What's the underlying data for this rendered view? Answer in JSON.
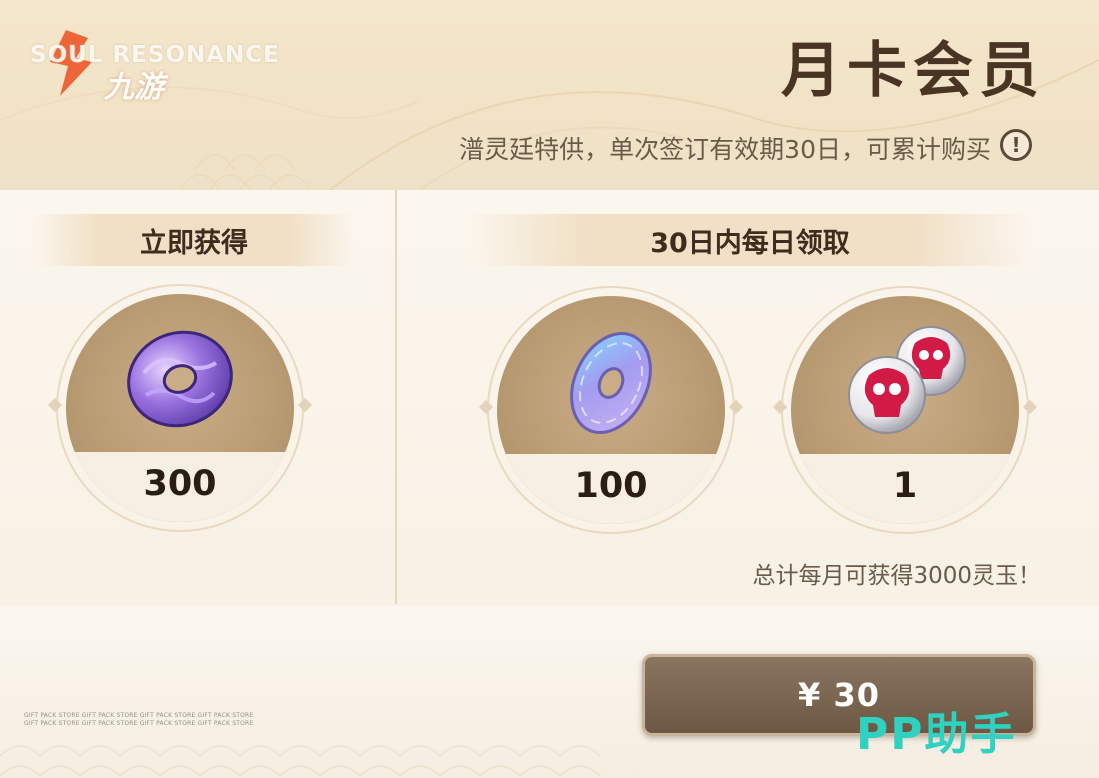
{
  "header": {
    "logo_text": "SOUL RESONANCE",
    "logo_sub": "九游",
    "title": "月卡会员",
    "subtitle": "潽灵廷特供，单次签订有效期30日，可累计购买",
    "info_icon": "exclamation-circle-icon"
  },
  "left_panel": {
    "heading": "立即获得",
    "reward": {
      "icon": "violet-jade-coin-icon",
      "quantity": "300"
    }
  },
  "right_panel": {
    "heading": "30日内每日领取",
    "rewards": [
      {
        "icon": "jade-disc-coin-icon",
        "quantity": "100"
      },
      {
        "icon": "crimson-skull-orbs-icon",
        "quantity": "1"
      }
    ],
    "total_note": "总计每月可获得3000灵玉！"
  },
  "purchase": {
    "price_label": "¥ 30"
  },
  "watermark": "PP助手",
  "fine_print": "GIFT PACK STORE GIFT PACK STORE GIFT PACK STORE GIFT PACK STORE GIFT PACK STORE GIFT PACK STORE GIFT PACK STORE GIFT PACK STORE",
  "colors": {
    "title": "#4a3524",
    "button": "#7a6450",
    "watermark": "#2fd1c0",
    "medallion": "#b89a72"
  }
}
